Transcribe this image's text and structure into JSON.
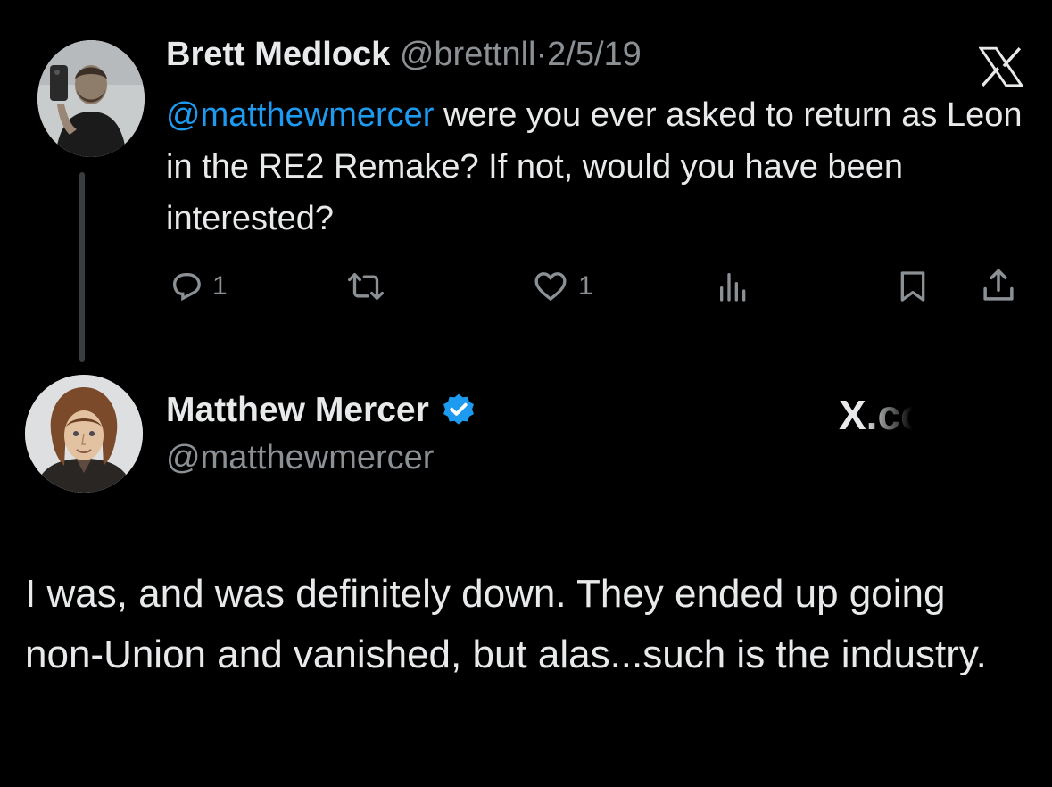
{
  "reply_tweet": {
    "author_name": "Brett Medlock",
    "handle": "@brettnll",
    "separator": "·",
    "date": "2/5/19",
    "mention": "@matthewmercer",
    "text": " were you ever asked to return as Leon in the RE2 Remake? If not, would you have been interested?",
    "actions": {
      "reply_count": "1",
      "repost_count": "",
      "like_count": "1"
    },
    "icons": [
      "reply-icon",
      "repost-icon",
      "like-icon",
      "views-icon",
      "bookmark-icon",
      "share-icon",
      "x-logo-icon"
    ]
  },
  "main_tweet": {
    "author_name": "Matthew Mercer",
    "handle": "@matthewmercer",
    "verified_icon": "verified-badge-icon",
    "text": "I was, and was definitely down. They ended up going non-Union and vanished, but alas...such is the industry."
  },
  "watermark": {
    "text": "X.co"
  },
  "colors": {
    "background": "#000000",
    "text": "#e7e9ea",
    "muted": "#8b9095",
    "accent": "#1d9bf0"
  }
}
